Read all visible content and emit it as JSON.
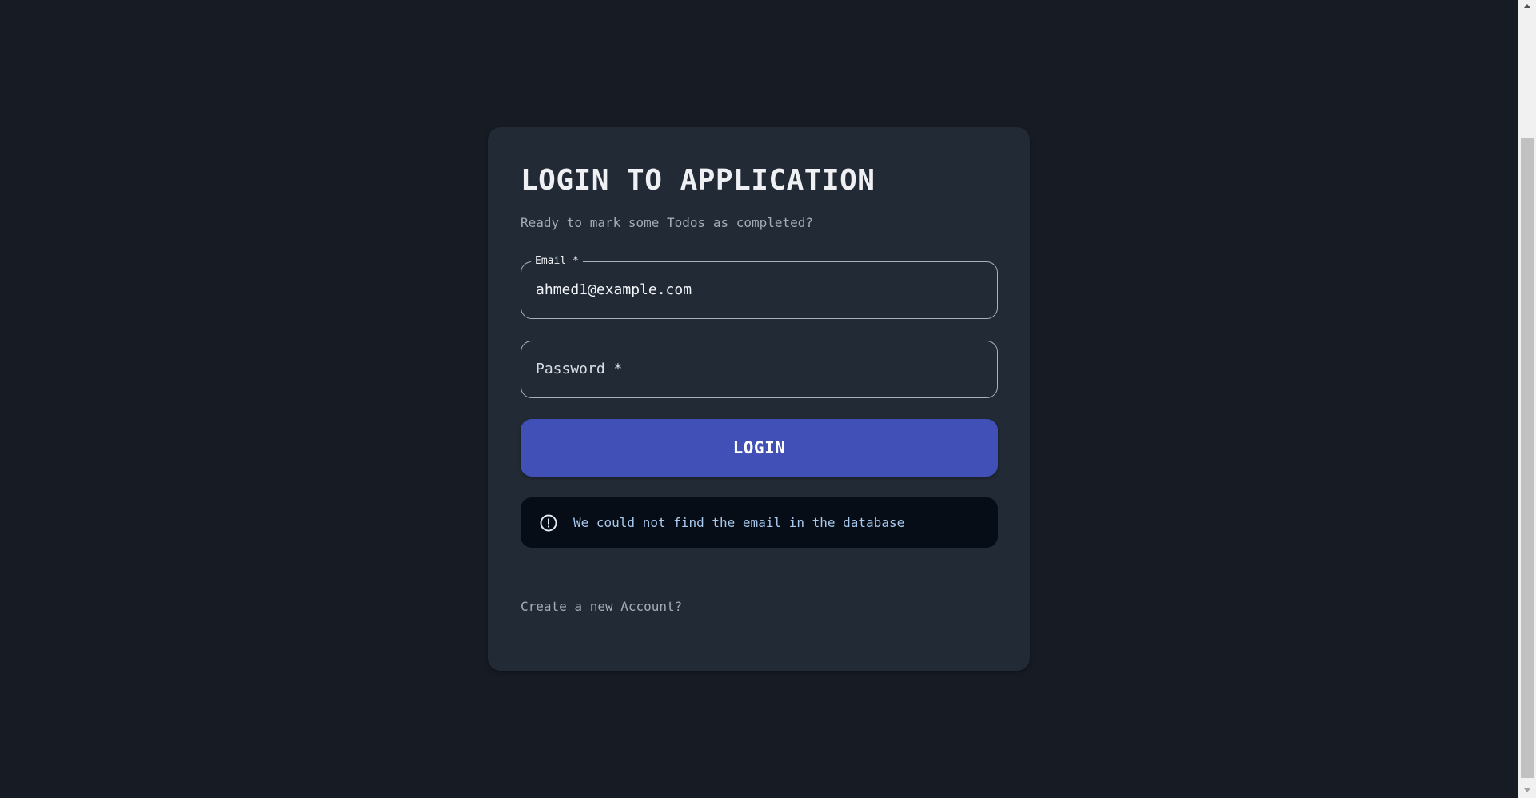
{
  "login": {
    "title": "LOGIN TO APPLICATION",
    "subtitle": "Ready to mark some Todos as completed?",
    "email": {
      "label": "Email *",
      "value": "ahmed1@example.com"
    },
    "password": {
      "placeholder": "Password *",
      "value": ""
    },
    "submit_label": "LOGIN",
    "alert": {
      "icon": "error-outline-icon",
      "message": "We could not find the email in the database"
    },
    "create_account_link": "Create a new Account?"
  },
  "colors": {
    "page_background": "#171c24",
    "card_background": "#222a35",
    "primary_button": "#4150b6",
    "alert_background": "#060d16",
    "alert_text": "#a9c9ee"
  },
  "scrollbar": {
    "up_icon": "scroll-up-arrow-icon",
    "down_icon": "scroll-down-arrow-icon"
  }
}
